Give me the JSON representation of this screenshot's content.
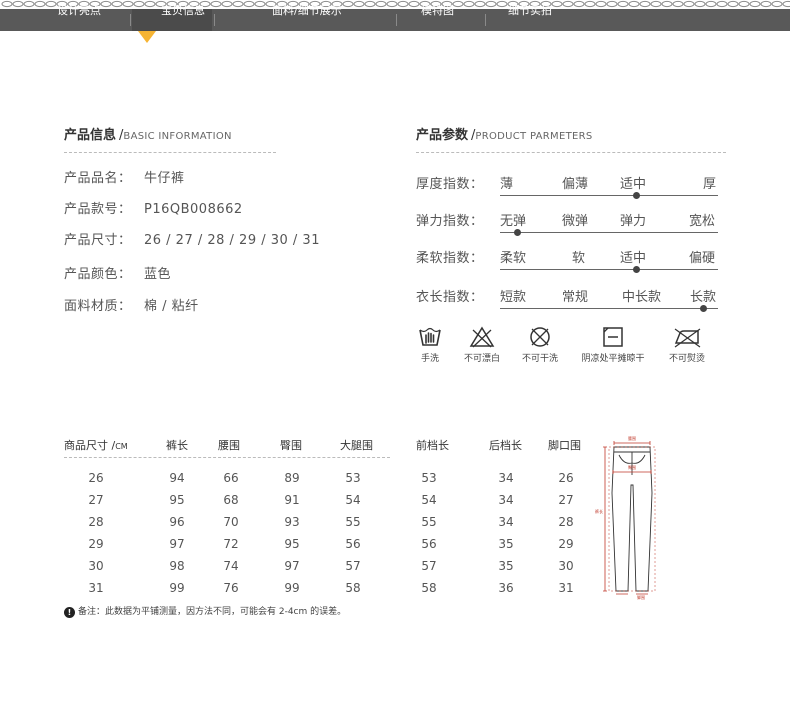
{
  "nav": {
    "items": [
      "设计亮点",
      "宝贝信息",
      "面料/细节展示",
      "模特图",
      "细节实拍"
    ],
    "active_index": 1,
    "accent_color": "#f6b433"
  },
  "info": {
    "title_cn": "产品信息",
    "title_en": "BASIC INFORMATION",
    "rows": [
      {
        "label": "产品品名：",
        "value": "牛仔裤"
      },
      {
        "label": "产品款号：",
        "value": "P16QB008662"
      },
      {
        "label": "产品尺寸：",
        "value": "26 / 27 / 28 / 29 / 30 / 31"
      },
      {
        "label": "产品颜色：",
        "value": "蓝色"
      },
      {
        "label": "面料材质：",
        "value": "棉 / 粘纤"
      }
    ]
  },
  "params": {
    "title_cn": "产品参数",
    "title_en": "PRODUCT PARMETERS",
    "rows": [
      {
        "label": "厚度指数：",
        "options": [
          "薄",
          "偏薄",
          "适中",
          "厚"
        ],
        "selected": 2
      },
      {
        "label": "弹力指数：",
        "options": [
          "无弹",
          "微弹",
          "弹力",
          "宽松"
        ],
        "selected": 0
      },
      {
        "label": "柔软指数：",
        "options": [
          "柔软",
          "软",
          "适中",
          "偏硬"
        ],
        "selected": 2
      },
      {
        "label": "衣长指数：",
        "options": [
          "短款",
          "常规",
          "中长款",
          "长款"
        ],
        "selected": 3
      }
    ]
  },
  "care": {
    "items": [
      {
        "icon": "hand-wash-icon",
        "label": "手洗"
      },
      {
        "icon": "no-bleach-icon",
        "label": "不可漂白"
      },
      {
        "icon": "no-dry-clean-icon",
        "label": "不可干洗"
      },
      {
        "icon": "shade-flat-dry-icon",
        "label": "阴凉处平摊晾干"
      },
      {
        "icon": "no-iron-icon",
        "label": "不可熨烫"
      }
    ]
  },
  "sizes": {
    "headers": [
      "商品尺寸 /",
      "裤长",
      "腰围",
      "臀围",
      "大腿围",
      "前档长",
      "后档长",
      "脚口围"
    ],
    "unit": "CM",
    "rows": [
      [
        "26",
        "94",
        "66",
        "89",
        "53",
        "53",
        "34",
        "26"
      ],
      [
        "27",
        "95",
        "68",
        "91",
        "54",
        "54",
        "34",
        "27"
      ],
      [
        "28",
        "96",
        "70",
        "93",
        "55",
        "55",
        "34",
        "28"
      ],
      [
        "29",
        "97",
        "72",
        "95",
        "56",
        "56",
        "35",
        "29"
      ],
      [
        "30",
        "98",
        "74",
        "97",
        "57",
        "57",
        "35",
        "30"
      ],
      [
        "31",
        "99",
        "76",
        "99",
        "58",
        "58",
        "36",
        "31"
      ]
    ],
    "note_icon": "exclamation-icon",
    "note": "备注：此数据为平铺测量，因方法不同，可能会有 2-4cm 的误差。"
  },
  "diagram": {
    "labels": {
      "waist": "腰围",
      "hip": "臀围",
      "length": "裤长",
      "hem": "脚围"
    },
    "line_color": "#c0392b"
  }
}
